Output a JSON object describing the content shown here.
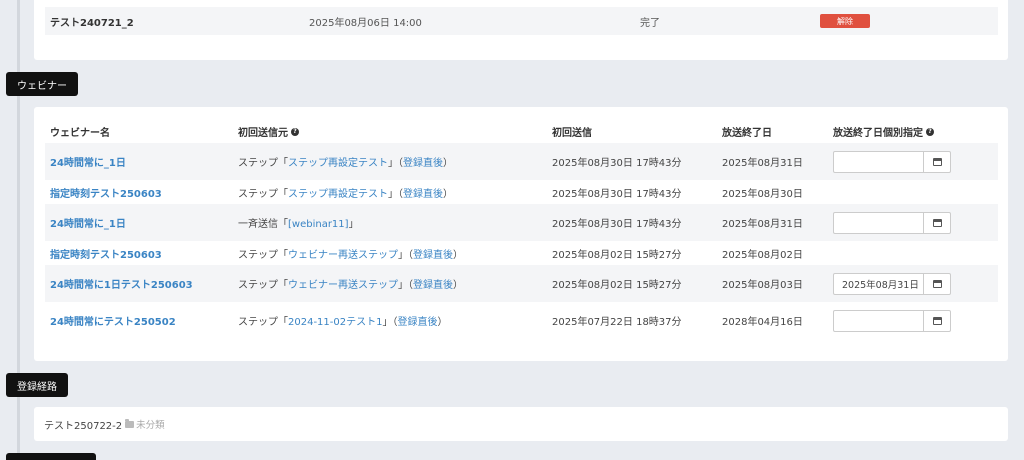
{
  "top_card": {
    "row": {
      "name": "テスト240721_2",
      "date": "2025年08月06日 14:00",
      "status": "完了",
      "button": "解除"
    }
  },
  "webinar_section": {
    "label": "ウェビナー",
    "headers": {
      "name": "ウェビナー名",
      "source": "初回送信元",
      "first_send": "初回送信",
      "end_date": "放送終了日",
      "end_override": "放送終了日個別指定"
    },
    "rows": [
      {
        "name": "24時間常に_1日",
        "src_prefix": "ステップ「",
        "src_link": "ステップ再設定テスト",
        "src_mid": "」（",
        "src_link2": "登録直後",
        "src_suffix": "）",
        "first_send": "2025年08月30日 17時43分",
        "end_date": "2025年08月31日",
        "has_input": true,
        "input_value": ""
      },
      {
        "name": "指定時刻テスト250603",
        "src_prefix": "ステップ「",
        "src_link": "ステップ再設定テスト",
        "src_mid": "」（",
        "src_link2": "登録直後",
        "src_suffix": "）",
        "first_send": "2025年08月30日 17時43分",
        "end_date": "2025年08月30日",
        "has_input": false,
        "input_value": ""
      },
      {
        "name": "24時間常に_1日",
        "src_prefix": "一斉送信「",
        "src_link": "[webinar11]",
        "src_mid": "」",
        "src_link2": "",
        "src_suffix": "",
        "first_send": "2025年08月30日 17時43分",
        "end_date": "2025年08月31日",
        "has_input": true,
        "input_value": ""
      },
      {
        "name": "指定時刻テスト250603",
        "src_prefix": "ステップ「",
        "src_link": "ウェビナー再送ステップ",
        "src_mid": "」（",
        "src_link2": "登録直後",
        "src_suffix": "）",
        "first_send": "2025年08月02日 15時27分",
        "end_date": "2025年08月02日",
        "has_input": false,
        "input_value": ""
      },
      {
        "name": "24時間常に1日テスト250603",
        "src_prefix": "ステップ「",
        "src_link": "ウェビナー再送ステップ",
        "src_mid": "」（",
        "src_link2": "登録直後",
        "src_suffix": "）",
        "first_send": "2025年08月02日 15時27分",
        "end_date": "2025年08月03日",
        "has_input": true,
        "input_value": "2025年08月31日"
      },
      {
        "name": "24時間常にテスト250502",
        "src_prefix": "ステップ「",
        "src_link": "2024-11-02テスト1",
        "src_mid": "」（",
        "src_link2": "登録直後",
        "src_suffix": "）",
        "first_send": "2025年07月22日 18時37分",
        "end_date": "2028年04月16日",
        "has_input": true,
        "input_value": ""
      }
    ]
  },
  "route_section": {
    "label": "登録経路",
    "name": "テスト250722-2",
    "category": "未分類"
  },
  "icons": {
    "help": "question-circle-icon",
    "calendar": "calendar-icon",
    "folder": "folder-icon"
  },
  "colors": {
    "link": "#3a84c4",
    "danger": "#e0503f",
    "label_bg": "#111111"
  }
}
